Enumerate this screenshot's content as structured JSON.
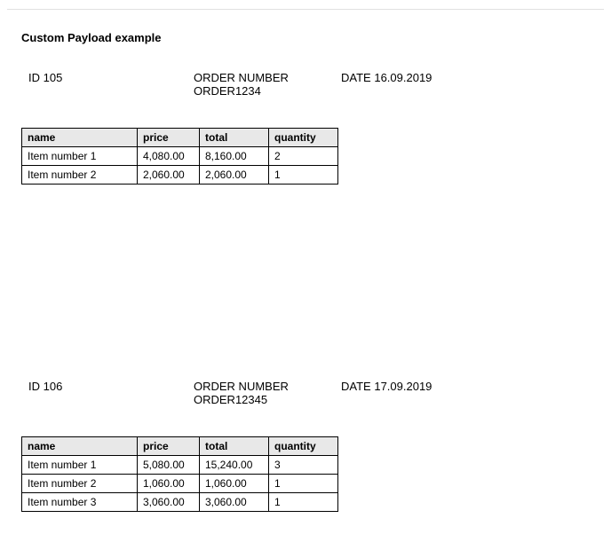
{
  "title": "Custom Payload example",
  "labels": {
    "id": "ID",
    "order_number": "ORDER NUMBER",
    "date": "DATE"
  },
  "columns": {
    "name": "name",
    "price": "price",
    "total": "total",
    "quantity": "quantity"
  },
  "orders": [
    {
      "id": "105",
      "order_number": "ORDER1234",
      "date": "16.09.2019",
      "items": [
        {
          "name": "Item number 1",
          "price": "4,080.00",
          "total": "8,160.00",
          "quantity": "2"
        },
        {
          "name": "Item number 2",
          "price": "2,060.00",
          "total": "2,060.00",
          "quantity": "1"
        }
      ]
    },
    {
      "id": "106",
      "order_number": "ORDER12345",
      "date": "17.09.2019",
      "items": [
        {
          "name": "Item number 1",
          "price": "5,080.00",
          "total": "15,240.00",
          "quantity": "3"
        },
        {
          "name": "Item number 2",
          "price": "1,060.00",
          "total": "1,060.00",
          "quantity": "1"
        },
        {
          "name": "Item number 3",
          "price": "3,060.00",
          "total": "3,060.00",
          "quantity": "1"
        }
      ]
    }
  ]
}
